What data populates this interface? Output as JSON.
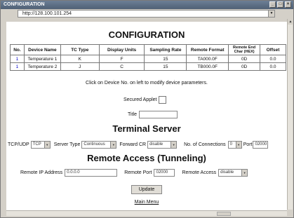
{
  "window": {
    "title": "CONFIGURATION",
    "controls": [
      "_",
      "□",
      "×"
    ]
  },
  "address": {
    "url": "http://128.100.101.254"
  },
  "page": {
    "title": "CONFIGURATION"
  },
  "table": {
    "headers": [
      "No.",
      "Device Name",
      "TC Type",
      "Display Units",
      "Sampling Rate",
      "Remote Format",
      "Remote End Char (HEX)",
      "Offset"
    ],
    "rows": [
      [
        "1",
        "Temperature 1",
        "K",
        "F",
        "15",
        "TA000.0F",
        "0D",
        "0.0"
      ],
      [
        "1",
        "Temperature 2",
        "J",
        "C",
        "15",
        "TB000.0F",
        "0D",
        "0.0"
      ]
    ]
  },
  "hint": "Click on Device No. on left to modify device parameters.",
  "secured_applet": {
    "label": "Secured Applet"
  },
  "title_field": {
    "label": "Title",
    "value": ""
  },
  "terminal_server": {
    "heading": "Terminal Server",
    "tcp_udp_label": "TCP/UDP",
    "tcp_udp_value": "TCP",
    "server_type_label": "Server Type",
    "server_type_value": "Continuous",
    "forward_cr_label": "Forward CR",
    "forward_cr_value": "disable",
    "connections_label": "No. of Connections",
    "connections_value": "0",
    "port_label": "Port",
    "port_value": "02000"
  },
  "remote_access": {
    "heading": "Remote Access (Tunneling)",
    "ip_label": "Remote IP Address",
    "ip_value": "0.0.0.0",
    "port_label": "Remote Port",
    "port_value": "02000",
    "access_label": "Remote Access",
    "access_value": "disable"
  },
  "update_button": "Update",
  "main_menu_link": "Main Menu"
}
